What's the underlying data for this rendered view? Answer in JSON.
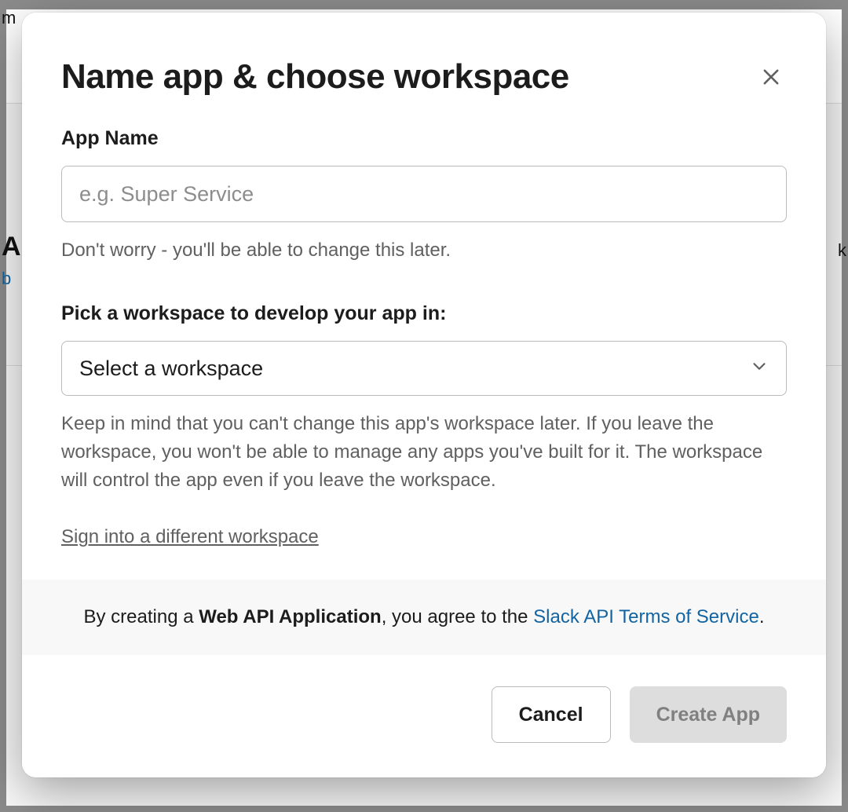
{
  "modal": {
    "title": "Name app & choose workspace",
    "app_name": {
      "label": "App Name",
      "placeholder": "e.g. Super Service",
      "value": "",
      "helper": "Don't worry - you'll be able to change this later."
    },
    "workspace": {
      "label": "Pick a workspace to develop your app in:",
      "placeholder": "Select a workspace",
      "helper": "Keep in mind that you can't change this app's workspace later. If you leave the workspace, you won't be able to manage any apps you've built for it. The workspace will control the app even if you leave the workspace."
    },
    "signin_link": "Sign into a different workspace",
    "tos": {
      "prefix": "By creating a ",
      "bold": "Web API Application",
      "middle": ", you agree to the ",
      "link": "Slack API Terms of Service",
      "suffix": "."
    },
    "buttons": {
      "cancel": "Cancel",
      "create": "Create App"
    }
  },
  "background": {
    "top_fragment": "m",
    "left_heading": "A",
    "left_sub": "b",
    "right_fragment": "k"
  }
}
